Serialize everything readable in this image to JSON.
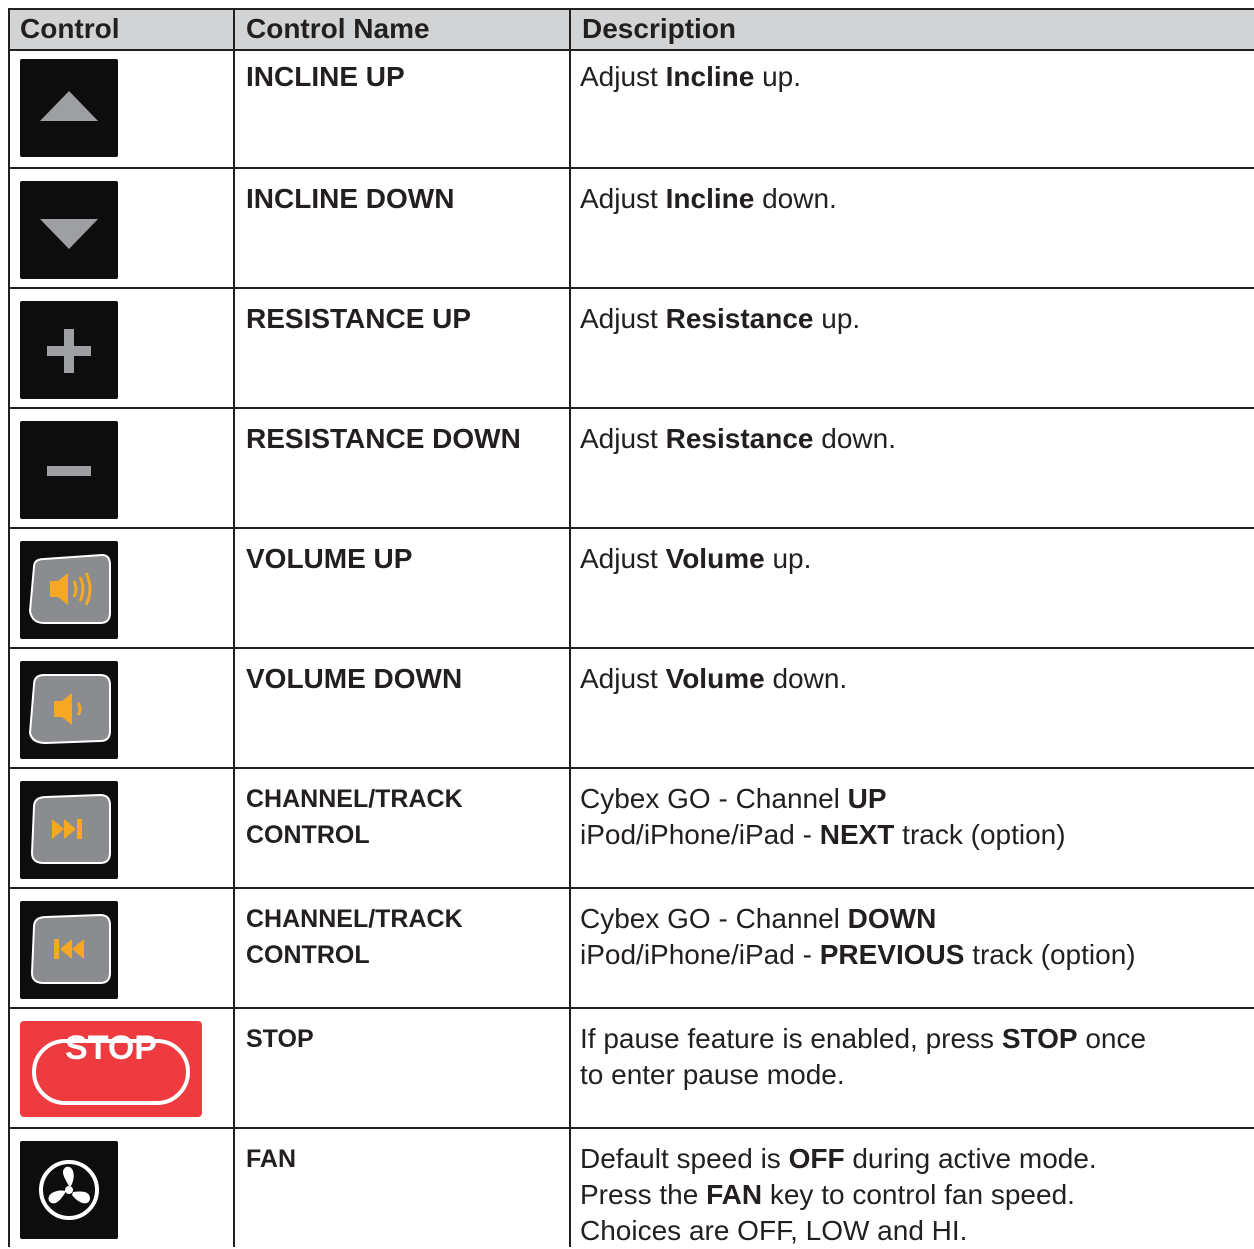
{
  "header": {
    "col_control": "Control",
    "col_name": "Control Name",
    "col_desc": "Description"
  },
  "rows": [
    {
      "icon": "incline-up-icon",
      "name": "INCLINE UP",
      "desc_pre": "Adjust ",
      "desc_bold": "Incline",
      "desc_post": " up."
    },
    {
      "icon": "incline-down-icon",
      "name": "INCLINE DOWN",
      "desc_pre": "Adjust ",
      "desc_bold": "Incline",
      "desc_post": " down."
    },
    {
      "icon": "plus-icon",
      "name": "RESISTANCE UP",
      "desc_pre": "Adjust ",
      "desc_bold": "Resistance",
      "desc_post": " up."
    },
    {
      "icon": "minus-icon",
      "name": "RESISTANCE DOWN",
      "desc_pre": "Adjust ",
      "desc_bold": "Resistance",
      "desc_post": " down."
    },
    {
      "icon": "volume-up-icon",
      "name": "VOLUME UP",
      "desc_pre": "Adjust ",
      "desc_bold": "Volume",
      "desc_post": " up."
    },
    {
      "icon": "volume-down-icon",
      "name": "VOLUME DOWN",
      "desc_pre": "Adjust ",
      "desc_bold": "Volume",
      "desc_post": " down."
    },
    {
      "icon": "next-track-icon",
      "name_l1": "CHANNEL/TRACK",
      "name_l2": "CONTROL",
      "d1_pre": "Cybex GO - Channel ",
      "d1_bold": "UP",
      "d2_pre": "iPod/iPhone/iPad - ",
      "d2_bold": "NEXT",
      "d2_post": " track (option)"
    },
    {
      "icon": "previous-track-icon",
      "name_l1": "CHANNEL/TRACK",
      "name_l2": "CONTROL",
      "d1_pre": "Cybex GO - Channel ",
      "d1_bold": "DOWN",
      "d2_pre": "iPod/iPhone/iPad - ",
      "d2_bold": "PREVIOUS",
      "d2_post": " track (option)"
    },
    {
      "icon": "stop-icon",
      "icon_text": "STOP",
      "name": "STOP",
      "d1_pre": "If pause feature is enabled, press ",
      "d1_bold": "STOP",
      "d1_post": " once",
      "d2": "to enter pause mode."
    },
    {
      "icon": "fan-icon",
      "name": "FAN",
      "d1_pre": "Default speed is ",
      "d1_bold": "OFF",
      "d1_post": " during active mode.",
      "d2_pre": "Press the ",
      "d2_bold": "FAN",
      "d2_post": " key to control fan speed.",
      "d3": "Choices are OFF, LOW and HI."
    }
  ],
  "colors": {
    "header_bg": "#d1d3d4",
    "stop_red": "#ee3b3f",
    "speaker_orange": "#f7a823",
    "icon_grey": "#9d9fa2"
  }
}
